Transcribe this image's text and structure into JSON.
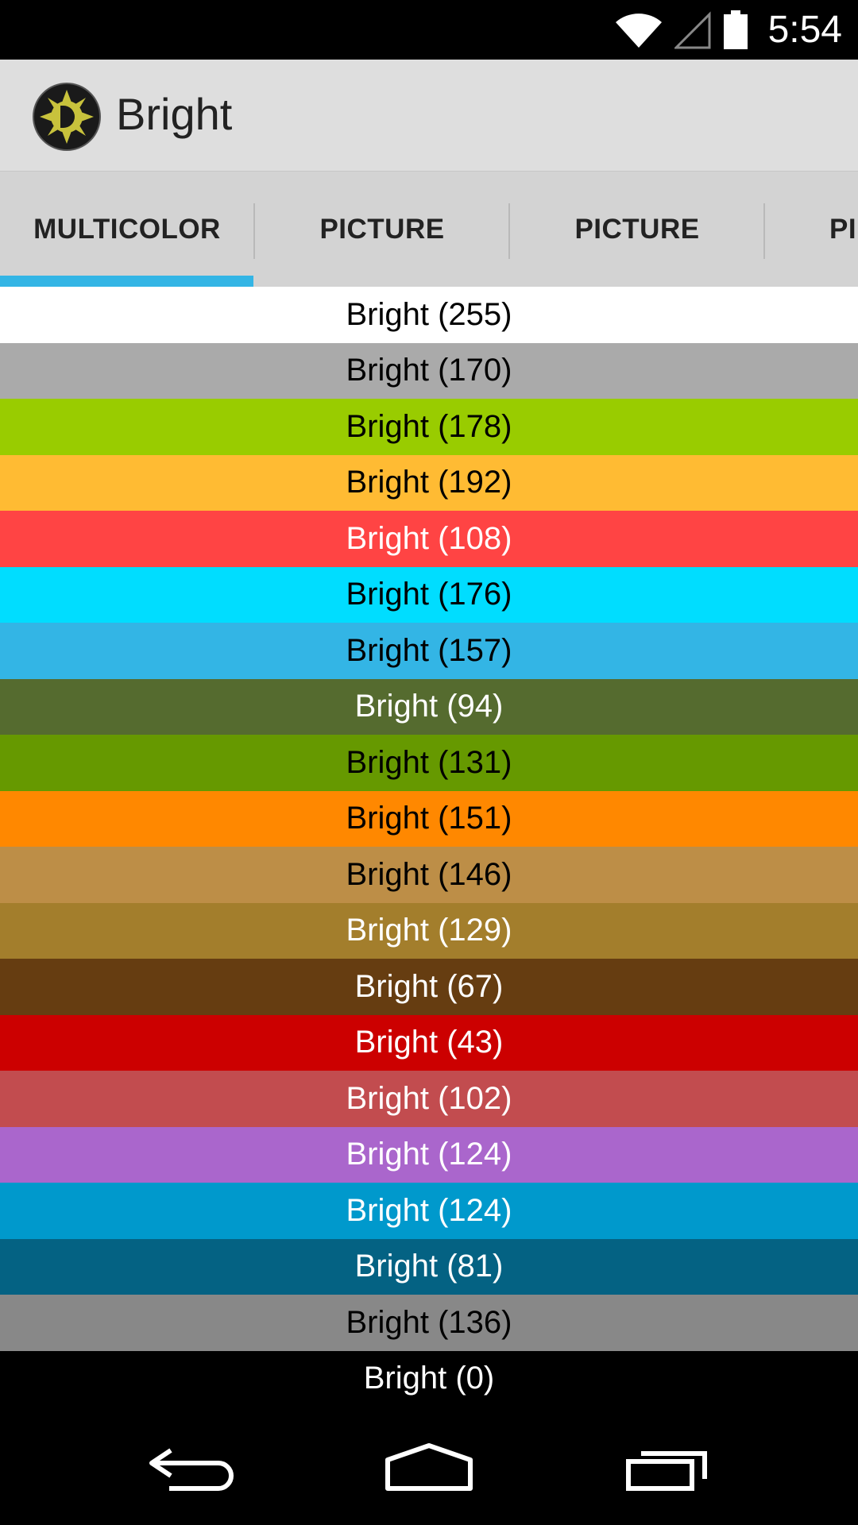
{
  "status_bar": {
    "time": "5:54",
    "icons": [
      "wifi-icon",
      "signal-icon",
      "battery-icon"
    ]
  },
  "action_bar": {
    "title": "Bright",
    "icon": "app-logo-icon"
  },
  "tabs": [
    {
      "label": "MULTICOLOR",
      "selected": true
    },
    {
      "label": "PICTURE",
      "selected": false
    },
    {
      "label": "PICTURE",
      "selected": false
    },
    {
      "label": "PI",
      "selected": false
    }
  ],
  "accent_color": "#33b5e5",
  "items": [
    {
      "label": "Bright (255)",
      "bg": "#ffffff",
      "fg": "#000000"
    },
    {
      "label": "Bright (170)",
      "bg": "#aaaaaa",
      "fg": "#000000"
    },
    {
      "label": "Bright (178)",
      "bg": "#99cc00",
      "fg": "#000000"
    },
    {
      "label": "Bright (192)",
      "bg": "#ffbb33",
      "fg": "#000000"
    },
    {
      "label": "Bright (108)",
      "bg": "#ff4444",
      "fg": "#ffffff"
    },
    {
      "label": "Bright (176)",
      "bg": "#00ddff",
      "fg": "#000000"
    },
    {
      "label": "Bright (157)",
      "bg": "#33b5e5",
      "fg": "#000000"
    },
    {
      "label": "Bright (94)",
      "bg": "#556b2f",
      "fg": "#ffffff"
    },
    {
      "label": "Bright (131)",
      "bg": "#669900",
      "fg": "#000000"
    },
    {
      "label": "Bright (151)",
      "bg": "#ff8800",
      "fg": "#000000"
    },
    {
      "label": "Bright (146)",
      "bg": "#bd8e47",
      "fg": "#000000"
    },
    {
      "label": "Bright (129)",
      "bg": "#a37e2c",
      "fg": "#ffffff"
    },
    {
      "label": "Bright (67)",
      "bg": "#663d11",
      "fg": "#ffffff"
    },
    {
      "label": "Bright (43)",
      "bg": "#cc0000",
      "fg": "#ffffff"
    },
    {
      "label": "Bright (102)",
      "bg": "#c24c4f",
      "fg": "#ffffff"
    },
    {
      "label": "Bright (124)",
      "bg": "#aa66cc",
      "fg": "#ffffff"
    },
    {
      "label": "Bright (124)",
      "bg": "#0099cc",
      "fg": "#ffffff"
    },
    {
      "label": "Bright (81)",
      "bg": "#046283",
      "fg": "#ffffff"
    },
    {
      "label": "Bright (136)",
      "bg": "#888888",
      "fg": "#000000"
    },
    {
      "label": "Bright (0)",
      "bg": "#000000",
      "fg": "#ffffff"
    }
  ],
  "nav_bar": {
    "buttons": [
      "back-icon",
      "home-icon",
      "recents-icon"
    ]
  }
}
